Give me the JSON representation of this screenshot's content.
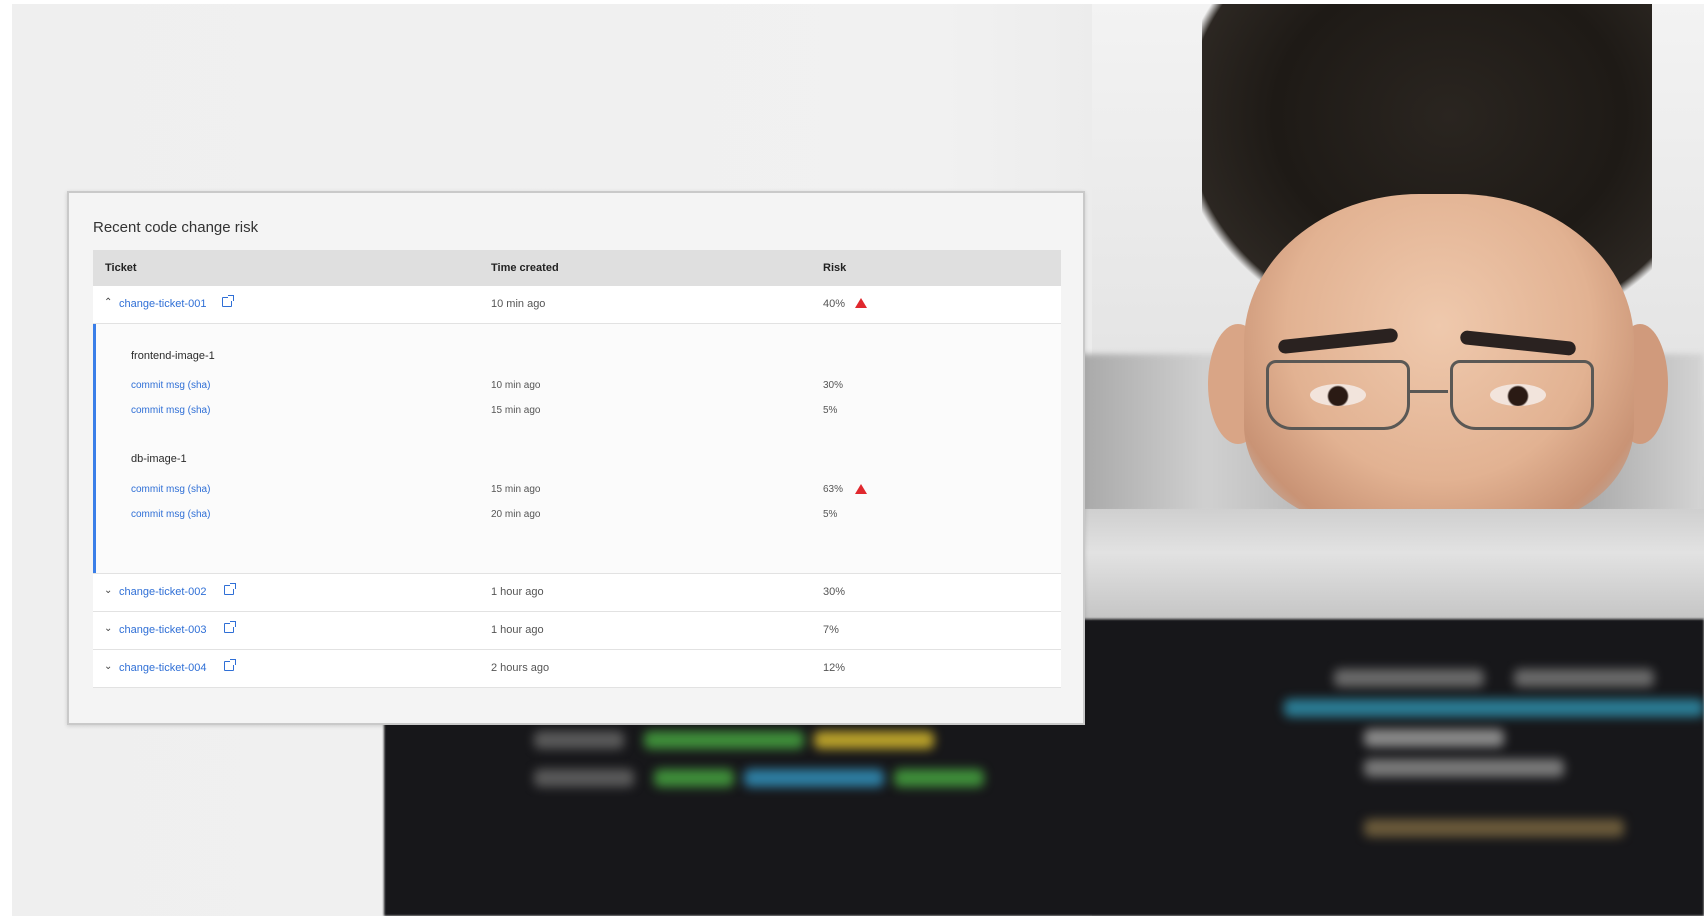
{
  "card": {
    "title": "Recent code change risk",
    "columns": {
      "ticket": "Ticket",
      "time": "Time created",
      "risk": "Risk"
    }
  },
  "rows": [
    {
      "ticket": "change-ticket-001",
      "time": "10 min ago",
      "risk": "40%",
      "warning": true,
      "expanded": true,
      "chevron": "chevron-up-icon"
    },
    {
      "ticket": "change-ticket-002",
      "time": "1 hour ago",
      "risk": "30%",
      "warning": false,
      "chevron": "chevron-down-icon"
    },
    {
      "ticket": "change-ticket-003",
      "time": "1 hour ago",
      "risk": "7%",
      "warning": false,
      "chevron": "chevron-down-icon"
    },
    {
      "ticket": "change-ticket-004",
      "time": "2 hours ago",
      "risk": "12%",
      "warning": false,
      "chevron": "chevron-down-icon"
    }
  ],
  "expanded": {
    "groups": [
      {
        "name": "frontend-image-1",
        "commits": [
          {
            "label": "commit msg (sha)",
            "time": "10 min ago",
            "risk": "30%",
            "warning": false
          },
          {
            "label": "commit msg (sha)",
            "time": "15 min ago",
            "risk": "5%",
            "warning": false
          }
        ]
      },
      {
        "name": "db-image-1",
        "commits": [
          {
            "label": "commit msg (sha)",
            "time": "15 min ago",
            "risk": "63%",
            "warning": true
          },
          {
            "label": "commit msg (sha)",
            "time": "20 min ago",
            "risk": "5%",
            "warning": false
          }
        ]
      }
    ]
  },
  "colors": {
    "link": "#2f6fd6",
    "accent_bar": "#3a7ee8",
    "warning": "#e0282e",
    "header_bg": "#dfdfdf"
  }
}
